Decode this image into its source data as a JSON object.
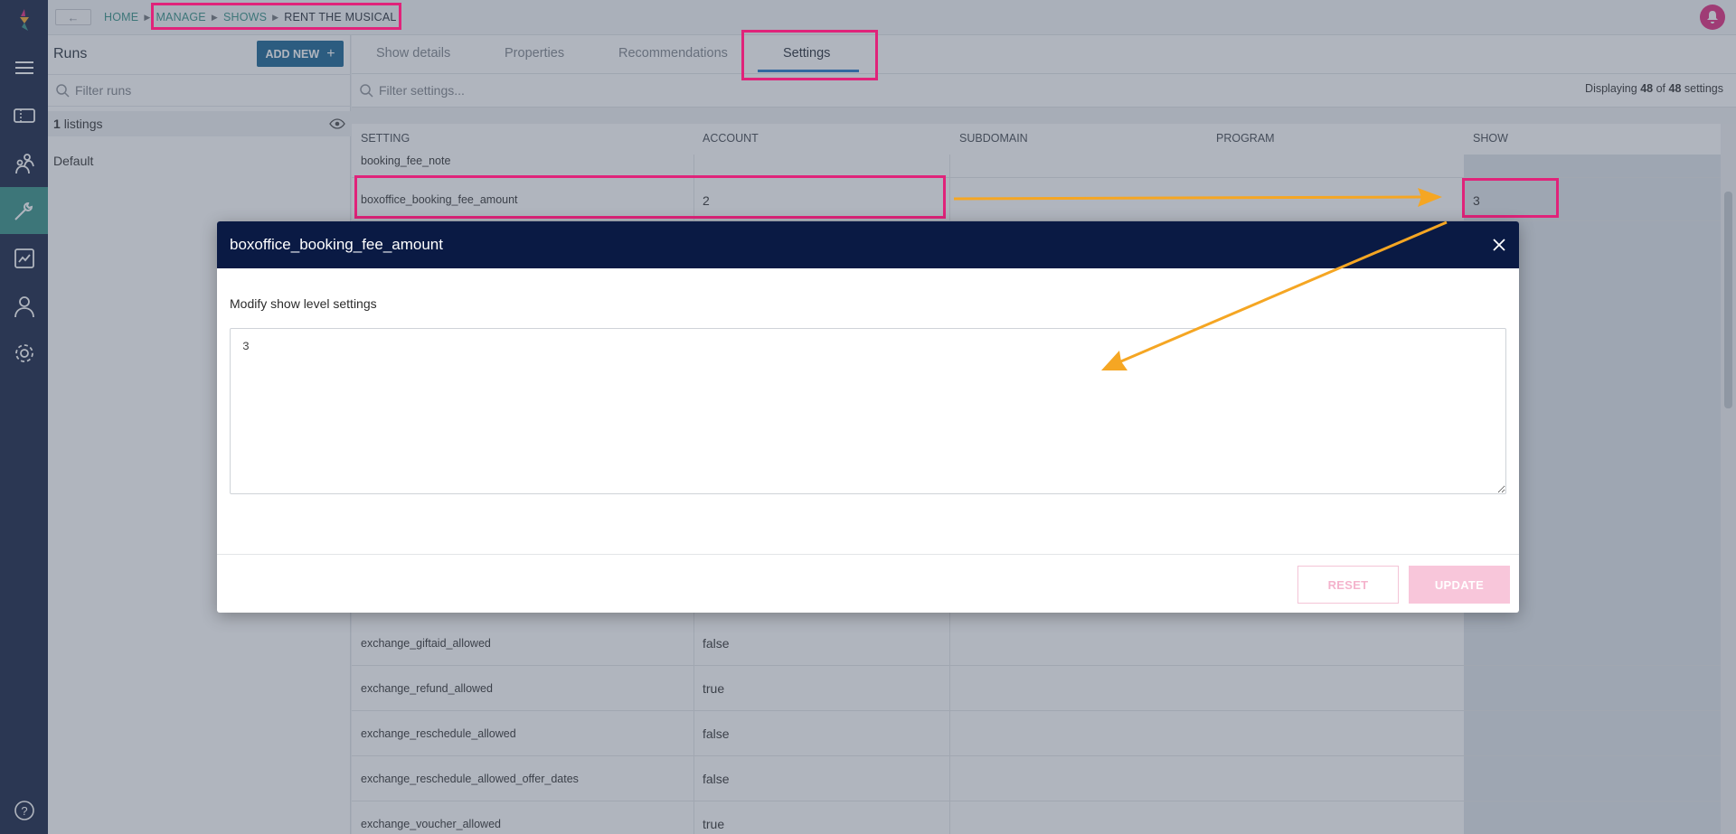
{
  "topbar": {
    "back_label": "←",
    "breadcrumbs": [
      "HOME",
      "MANAGE",
      "SHOWS",
      "RENT THE MUSICAL"
    ]
  },
  "nav": {
    "items": [
      "menu-icon",
      "tickets-icon",
      "audience-icon",
      "tools-icon",
      "reports-icon",
      "user-icon",
      "settings-icon",
      "help-icon"
    ],
    "active": "tools-icon"
  },
  "runs_panel": {
    "title": "Runs",
    "add_new_label": "ADD NEW",
    "filter_placeholder": "Filter runs",
    "listings_count": "1",
    "listings_label": "listings",
    "runs": [
      "Default"
    ]
  },
  "tabs": [
    {
      "label": "Show details"
    },
    {
      "label": "Properties"
    },
    {
      "label": "Recommendations"
    },
    {
      "label": "Settings",
      "active": true
    }
  ],
  "settings": {
    "filter_placeholder": "Filter settings...",
    "display_prefix": "Displaying",
    "display_shown": "48",
    "display_of": "of",
    "display_total": "48",
    "display_suffix": "settings",
    "columns": [
      "SETTING",
      "ACCOUNT",
      "SUBDOMAIN",
      "PROGRAM",
      "SHOW"
    ],
    "rows": [
      {
        "setting": "booking_fee_note",
        "account": "",
        "show": ""
      },
      {
        "setting": "boxoffice_booking_fee_amount",
        "account": "2",
        "show": "3"
      },
      {
        "setting": "exchange_giftaid_allowed",
        "account": "false",
        "show": ""
      },
      {
        "setting": "exchange_refund_allowed",
        "account": "true",
        "show": ""
      },
      {
        "setting": "exchange_reschedule_allowed",
        "account": "false",
        "show": ""
      },
      {
        "setting": "exchange_reschedule_allowed_offer_dates",
        "account": "false",
        "show": ""
      },
      {
        "setting": "exchange_voucher_allowed",
        "account": "true",
        "show": ""
      }
    ]
  },
  "modal": {
    "title": "boxoffice_booking_fee_amount",
    "label": "Modify show level settings",
    "value": "3",
    "reset_label": "RESET",
    "update_label": "UPDATE"
  },
  "colors": {
    "nav_bg": "#0e1b3d",
    "nav_active": "#2e8c82",
    "primary": "#0f5e8f",
    "modal_header": "#0a1a44",
    "highlight": "#e0237a",
    "arrow": "#f5a623",
    "tab_underline": "#1b74c9"
  }
}
